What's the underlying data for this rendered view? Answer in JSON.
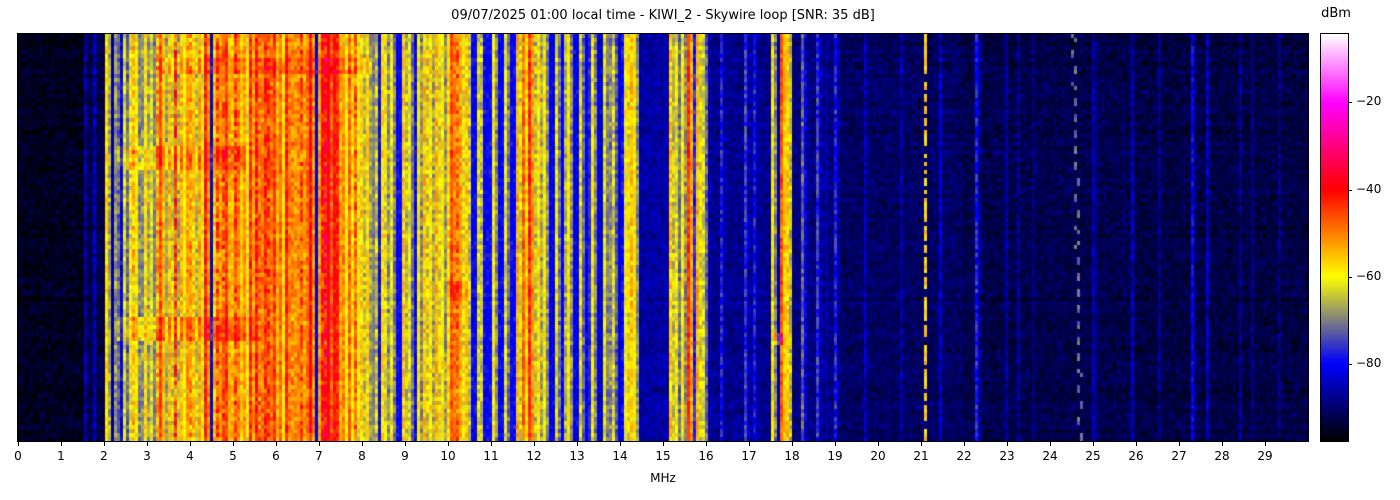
{
  "header": {
    "title": "09/07/2025 01:00 local time - KIWI_2 - Skywire loop [SNR: 35 dB]",
    "datetime_local": "09/07/2025 01:00",
    "station": "KIWI_2",
    "antenna": "Skywire loop",
    "snr_label": "SNR: 35 dB"
  },
  "chart_data": {
    "type": "heatmap",
    "subtype": "radio-spectrogram-waterfall",
    "title": "09/07/2025 01:00 local time - KIWI_2 - Skywire loop [SNR: 35 dB]",
    "xlabel": "MHz",
    "x_range": [
      0,
      30
    ],
    "x_ticks": [
      0,
      1,
      2,
      3,
      4,
      5,
      6,
      7,
      8,
      9,
      10,
      11,
      12,
      13,
      14,
      15,
      16,
      17,
      18,
      19,
      20,
      21,
      22,
      23,
      24,
      25,
      26,
      27,
      28,
      29
    ],
    "grid": false,
    "legend": "none",
    "colorbar": {
      "label": "dBm",
      "position": "right",
      "vmin": -97.7,
      "vmax": -4.3,
      "ticks": [
        {
          "value": -20,
          "label": "−20"
        },
        {
          "value": -40,
          "label": "−40"
        },
        {
          "value": -60,
          "label": "−60"
        },
        {
          "value": -80,
          "label": "−80"
        }
      ],
      "colormap_stops": [
        [
          -97.7,
          "#000000"
        ],
        [
          -80.0,
          "#0000ff"
        ],
        [
          -60.0,
          "#ffff00"
        ],
        [
          -40.0,
          "#ff0000"
        ],
        [
          -20.0,
          "#ff00ff"
        ],
        [
          -4.3,
          "#ffffff"
        ]
      ]
    },
    "noise_floor_bands_mhz_dbm": [
      [
        0.0,
        1.55,
        -95.5,
        0.02,
        6,
        0,
        0
      ],
      [
        1.55,
        2.1,
        -93,
        0.05,
        12,
        0,
        0
      ],
      [
        2.1,
        2.6,
        -87,
        0.12,
        16,
        0,
        0
      ],
      [
        2.6,
        3.15,
        -79,
        0.38,
        22,
        0.15,
        8
      ],
      [
        3.15,
        3.65,
        -75,
        0.45,
        24,
        0.2,
        8
      ],
      [
        3.65,
        4.45,
        -72,
        0.5,
        26,
        0.22,
        10
      ],
      [
        4.45,
        5.1,
        -73,
        0.5,
        26,
        0.22,
        10
      ],
      [
        5.1,
        6.45,
        -68,
        0.55,
        26,
        0.28,
        12
      ],
      [
        6.45,
        7.55,
        -70,
        0.5,
        28,
        0.25,
        11
      ],
      [
        7.55,
        8.3,
        -74,
        0.45,
        24,
        0.2,
        9
      ],
      [
        8.3,
        9.35,
        -80,
        0.2,
        18,
        0,
        0
      ],
      [
        9.35,
        10.0,
        -78,
        0.28,
        18,
        0.1,
        6
      ],
      [
        10.0,
        10.45,
        -71,
        0.45,
        24,
        0.15,
        9
      ],
      [
        10.45,
        11.55,
        -80,
        0.18,
        16,
        0,
        0
      ],
      [
        11.55,
        12.25,
        -77,
        0.3,
        20,
        0.1,
        7
      ],
      [
        12.25,
        13.35,
        -81,
        0.16,
        14,
        0,
        0
      ],
      [
        13.35,
        14.0,
        -83,
        0.1,
        12,
        0,
        0
      ],
      [
        14.0,
        14.35,
        -79,
        0.3,
        18,
        0,
        0
      ],
      [
        14.35,
        15.0,
        -86.5,
        0.05,
        8,
        0,
        0
      ],
      [
        15.0,
        16.1,
        -86,
        0.05,
        8,
        0,
        0
      ],
      [
        16.1,
        18.0,
        -88,
        0.04,
        6,
        0,
        0
      ],
      [
        18.0,
        19.0,
        -89,
        0.04,
        6,
        0,
        0
      ],
      [
        19.0,
        22.0,
        -91,
        0.03,
        4,
        0,
        0
      ],
      [
        22.0,
        26.0,
        -92.5,
        0.02,
        3,
        0,
        0
      ],
      [
        26.0,
        30.0,
        -93,
        0.02,
        3,
        0,
        0
      ]
    ],
    "carriers_mhz_dbm": [
      [
        1.5,
        -86
      ],
      [
        1.72,
        -85
      ],
      [
        2.05,
        -58
      ],
      [
        2.2,
        -68
      ],
      [
        2.32,
        -72
      ],
      [
        2.45,
        -63
      ],
      [
        2.6,
        -62
      ],
      [
        2.75,
        -60
      ],
      [
        2.9,
        -58
      ],
      [
        3.05,
        -62
      ],
      [
        3.26,
        -46
      ],
      [
        3.35,
        -58
      ],
      [
        3.48,
        -55
      ],
      [
        3.6,
        -57
      ],
      [
        3.75,
        -54
      ],
      [
        3.9,
        -52
      ],
      [
        4.05,
        -56
      ],
      [
        4.2,
        -53
      ],
      [
        4.35,
        -42
      ],
      [
        4.5,
        -55
      ],
      [
        4.65,
        -52
      ],
      [
        4.8,
        -45
      ],
      [
        4.95,
        -54
      ],
      [
        5.06,
        -50
      ],
      [
        5.2,
        -53
      ],
      [
        5.35,
        -44
      ],
      [
        5.5,
        -50
      ],
      [
        5.62,
        -52
      ],
      [
        5.75,
        -48
      ],
      [
        5.85,
        -51
      ],
      [
        5.95,
        -45
      ],
      [
        6.07,
        -49
      ],
      [
        6.2,
        -43
      ],
      [
        6.3,
        -50
      ],
      [
        6.4,
        -52
      ],
      [
        6.5,
        -51
      ],
      [
        6.6,
        -53
      ],
      [
        6.7,
        -49
      ],
      [
        6.8,
        -42
      ],
      [
        6.95,
        -52
      ],
      [
        7.1,
        -48
      ],
      [
        7.22,
        -38
      ],
      [
        7.3,
        -40
      ],
      [
        7.38,
        -44
      ],
      [
        7.5,
        -51
      ],
      [
        7.65,
        -48
      ],
      [
        7.8,
        -53
      ],
      [
        7.95,
        -56
      ],
      [
        8.1,
        -58
      ],
      [
        8.46,
        -58
      ],
      [
        8.65,
        -61
      ],
      [
        8.9,
        -56
      ],
      [
        9.1,
        -62
      ],
      [
        9.25,
        -60
      ],
      [
        9.42,
        -55
      ],
      [
        9.55,
        -58
      ],
      [
        9.68,
        -54
      ],
      [
        9.82,
        -59
      ],
      [
        9.95,
        -57
      ],
      [
        10.05,
        -46
      ],
      [
        10.15,
        -50
      ],
      [
        10.28,
        -53
      ],
      [
        10.4,
        -56
      ],
      [
        10.7,
        -63
      ],
      [
        11.0,
        -60
      ],
      [
        11.28,
        -62
      ],
      [
        11.6,
        -54
      ],
      [
        11.73,
        -48
      ],
      [
        11.84,
        -43
      ],
      [
        11.95,
        -56
      ],
      [
        12.08,
        -58
      ],
      [
        12.2,
        -60
      ],
      [
        12.5,
        -62
      ],
      [
        12.78,
        -60
      ],
      [
        13.05,
        -63
      ],
      [
        13.3,
        -61
      ],
      [
        13.6,
        -62
      ],
      [
        13.8,
        -64
      ],
      [
        14.1,
        -59
      ],
      [
        14.22,
        -55
      ],
      [
        14.32,
        -60
      ],
      [
        15.12,
        -56
      ],
      [
        15.27,
        -62
      ],
      [
        15.4,
        -60
      ],
      [
        15.55,
        -44
      ],
      [
        15.77,
        -54
      ],
      [
        15.92,
        -63
      ],
      [
        16.3,
        -78
      ],
      [
        16.85,
        -76
      ],
      [
        17.1,
        -79
      ],
      [
        17.5,
        -61
      ],
      [
        17.7,
        -47
      ],
      [
        17.88,
        -56
      ],
      [
        18.2,
        -73
      ],
      [
        18.55,
        -76
      ],
      [
        18.95,
        -78
      ],
      [
        19.7,
        -85
      ],
      [
        20.5,
        -86
      ],
      [
        21.45,
        -84
      ],
      [
        22.25,
        -78
      ],
      [
        23.2,
        -88
      ],
      [
        25.0,
        -86
      ],
      [
        25.85,
        -85
      ],
      [
        26.5,
        -88
      ],
      [
        27.25,
        -81
      ],
      [
        27.6,
        -84
      ],
      [
        28.4,
        -88
      ],
      [
        29.3,
        -89
      ]
    ],
    "dashed_carriers_mhz_dbm": [
      [
        21.05,
        -56
      ]
    ],
    "drifting_carrier": {
      "f_top_mhz": 24.52,
      "f_bottom_mhz": 24.68,
      "level_dbm": -72
    },
    "time_events": [
      {
        "rows": [
          0.05,
          0.09
        ],
        "f": [
          3.2,
          8.2
        ],
        "boost": 4
      },
      {
        "rows": [
          0.27,
          0.33
        ],
        "f": [
          2.3,
          5.3
        ],
        "boost": 5
      },
      {
        "rows": [
          0.69,
          0.75
        ],
        "f": [
          2.3,
          5.5
        ],
        "boost": 6
      },
      {
        "rows": [
          0.6,
          0.65
        ],
        "f": [
          9.95,
          10.55
        ],
        "boost": 5
      },
      {
        "rows": [
          0.73,
          0.76
        ],
        "f": [
          17.6,
          17.76
        ],
        "boost": 14
      }
    ]
  }
}
